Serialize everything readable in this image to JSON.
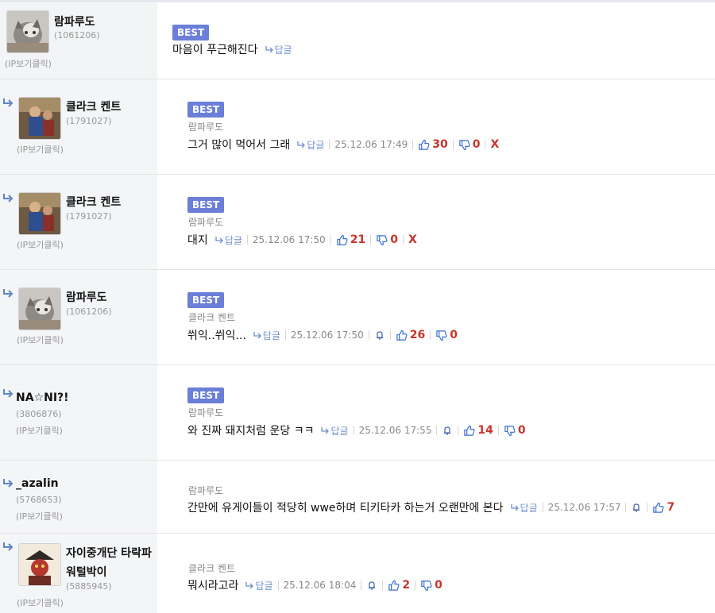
{
  "ip_label": "(IP보기클릭)",
  "reply_label": "답글",
  "comments": [
    {
      "nick": "람파루도",
      "uid": "(1061206)",
      "best": "BEST",
      "text": "마음이 푸근해진다"
    },
    {
      "nick": "클라크 켄트",
      "uid": "(1791027)",
      "best": "BEST",
      "target": "람파루도",
      "text": "그거 많이 먹어서 그래",
      "date": "25.12.06 17:49",
      "up": "30",
      "down": "0",
      "x": "X"
    },
    {
      "nick": "클라크 켄트",
      "uid": "(1791027)",
      "best": "BEST",
      "target": "람파루도",
      "text": "대지",
      "date": "25.12.06 17:50",
      "up": "21",
      "down": "0",
      "x": "X"
    },
    {
      "nick": "람파루도",
      "uid": "(1061206)",
      "best": "BEST",
      "target": "클라크 켄트",
      "text": "쒸익..쒸익...",
      "date": "25.12.06 17:50",
      "up": "26",
      "down": "0"
    },
    {
      "nick": "NA☆NI?!",
      "uid": "(3806876)",
      "best": "BEST",
      "target": "람파루도",
      "text": "와 진짜 돼지처럼 운당 ㅋㅋ",
      "date": "25.12.06 17:55",
      "up": "14",
      "down": "0"
    },
    {
      "nick": "_azalin",
      "uid": "(5768653)",
      "target": "람파루도",
      "text": "간만에 유게이들이 적당히 wwe하며 티키타카 하는거 오랜만에 본다",
      "date": "25.12.06 17:57",
      "up": "7"
    },
    {
      "nick": "자이중개단 타락파 워털박이",
      "nick1": "자이중개단 타락파",
      "nick2": "워털박이",
      "uid": "(5885945)",
      "target": "클라크 켄트",
      "text": "뭐시라고라",
      "date": "25.12.06 18:04",
      "up": "2",
      "down": "0"
    }
  ]
}
